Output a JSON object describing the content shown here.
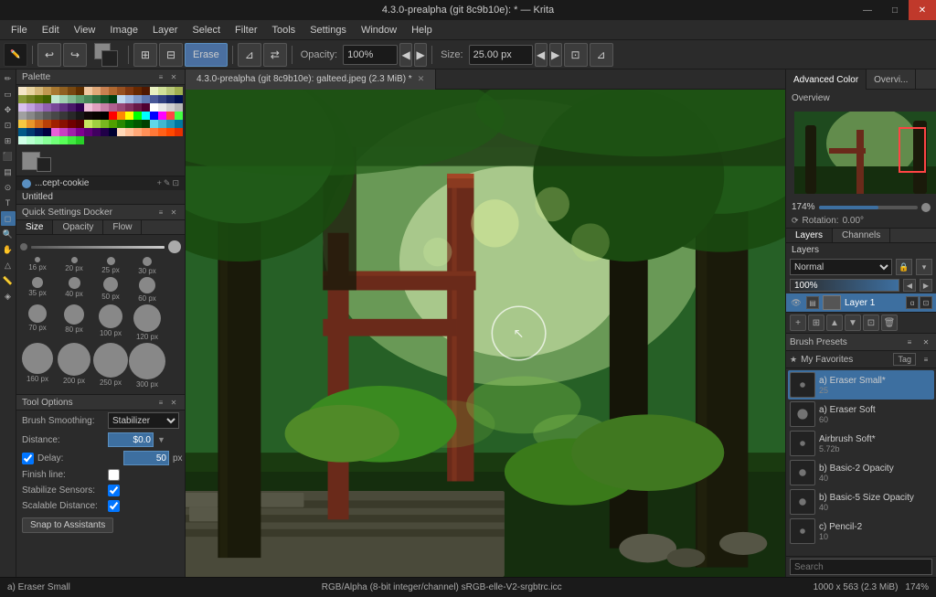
{
  "app": {
    "title": "4.3.0-prealpha (git 8c9b10e): * — Krita",
    "version": "4.3.0-prealpha (git 8c9b10e)"
  },
  "titlebar": {
    "title": "4.3.0-prealpha (git 8c9b10e): * — Krita",
    "minimize_label": "—",
    "maximize_label": "□",
    "close_label": "✕"
  },
  "menubar": {
    "items": [
      "File",
      "Edit",
      "View",
      "Image",
      "Layer",
      "Select",
      "Filter",
      "Tools",
      "Settings",
      "Window",
      "Help"
    ]
  },
  "toolbar": {
    "erase_label": "Erase",
    "opacity_label": "Opacity:",
    "opacity_value": "100%",
    "size_label": "Size:",
    "size_value": "25.00 px"
  },
  "canvas_tab": {
    "title": "4.3.0-prealpha (git 8c9b10e): galteed.jpeg (2.3 MiB) *"
  },
  "palette": {
    "title": "Palette",
    "swatch_name": "...cept-cookie",
    "colors": [
      "#f5e6c8",
      "#e8d4a0",
      "#d4b878",
      "#c09850",
      "#a87830",
      "#906020",
      "#784810",
      "#603000",
      "#f0c8a0",
      "#e0a878",
      "#c88050",
      "#b06830",
      "#985020",
      "#803810",
      "#682800",
      "#501800",
      "#e8f0c0",
      "#d0e098",
      "#b8c878",
      "#a0b050",
      "#889838",
      "#708020",
      "#587008",
      "#406000",
      "#c0e8d0",
      "#a0d0b0",
      "#80b890",
      "#60a070",
      "#488858",
      "#307040",
      "#185828",
      "#004010",
      "#c0d8f0",
      "#a0b8e0",
      "#8098c8",
      "#6078b0",
      "#485898",
      "#304080",
      "#182868",
      "#001050",
      "#d8c0f0",
      "#c0a0e0",
      "#a880c8",
      "#9060b0",
      "#784898",
      "#603080",
      "#481868",
      "#300050",
      "#f0c0d8",
      "#e0a0c0",
      "#c880a8",
      "#b06090",
      "#984878",
      "#803060",
      "#681848",
      "#500030",
      "#ffffff",
      "#e8e8e8",
      "#d0d0d0",
      "#b8b8b8",
      "#a0a0a0",
      "#888888",
      "#707070",
      "#585858",
      "#484848",
      "#383838",
      "#282828",
      "#181818",
      "#100808",
      "#080400",
      "#000000",
      "#ff0000",
      "#ff8800",
      "#ffff00",
      "#00ff00",
      "#00ffff",
      "#0000ff",
      "#ff00ff",
      "#ff4444",
      "#44ff44",
      "#f5c842",
      "#e8962a",
      "#d06818",
      "#b84008",
      "#a02000",
      "#881000",
      "#700000",
      "#580000",
      "#c8e860",
      "#a0d040",
      "#78b820",
      "#50a000",
      "#288800",
      "#007000",
      "#005800",
      "#004000",
      "#60d8e8",
      "#40b8d0",
      "#2098b8",
      "#0078a0",
      "#005888",
      "#003870",
      "#001858",
      "#000040",
      "#e860d8",
      "#c840c0",
      "#a020a8",
      "#800090",
      "#600078",
      "#400060",
      "#200048",
      "#000030",
      "#ffd8b8",
      "#ffc098",
      "#ffa878",
      "#ff9058",
      "#ff7838",
      "#ff6018",
      "#ff4800",
      "#e83000",
      "#d0ffe8",
      "#b8ffd0",
      "#a0ffb8",
      "#88ff98",
      "#70ff78",
      "#58ff58",
      "#40e840",
      "#28d028"
    ]
  },
  "quick_settings": {
    "title": "Quick Settings Docker",
    "tabs": [
      "Size",
      "Opacity",
      "Flow"
    ],
    "active_tab": "Size",
    "sizes": [
      {
        "label": "16 px",
        "size": 6
      },
      {
        "label": "20 px",
        "size": 7
      },
      {
        "label": "25 px",
        "size": 9
      },
      {
        "label": "30 px",
        "size": 10
      },
      {
        "label": "35 px",
        "size": 12
      },
      {
        "label": "40 px",
        "size": 13
      },
      {
        "label": "50 px",
        "size": 16
      },
      {
        "label": "60 px",
        "size": 18
      },
      {
        "label": "70 px",
        "size": 20
      },
      {
        "label": "80 px",
        "size": 22
      },
      {
        "label": "100 px",
        "size": 26
      },
      {
        "label": "120 px",
        "size": 30
      },
      {
        "label": "160 px",
        "size": 34
      },
      {
        "label": "200 px",
        "size": 36
      },
      {
        "label": "250 px",
        "size": 38
      },
      {
        "label": "300 px",
        "size": 40
      }
    ]
  },
  "tool_options": {
    "title": "Tool Options",
    "brush_smoothing_label": "Brush Smoothing:",
    "brush_smoothing_value": "Stabilizer",
    "distance_label": "Distance:",
    "distance_value": "$0.0",
    "delay_label": "Delay:",
    "delay_value": "50",
    "delay_unit": "px",
    "finish_line_label": "Finish line:",
    "stabilize_sensors_label": "Stabilize Sensors:",
    "scalable_distance_label": "Scalable Distance:",
    "snap_btn_label": "Snap to Assistants"
  },
  "right_panel": {
    "advanced_color_tab": "Advanced Color",
    "overview_tab": "Overvi...",
    "overview_title": "Overview",
    "zoom_value": "174%",
    "rotation_label": "Rotation:",
    "rotation_value": "0.00°"
  },
  "layers": {
    "title": "Layers",
    "tabs": [
      "Layers",
      "Channels"
    ],
    "active_tab": "Layers",
    "blend_mode": "Normal",
    "opacity_value": "100%",
    "items": [
      {
        "name": "Layer 1",
        "visible": true,
        "active": true
      }
    ]
  },
  "brush_presets": {
    "title": "Brush Presets",
    "category": "My Favorites",
    "tag_label": "Tag",
    "items": [
      {
        "size": "25",
        "name": "a) Eraser Small*",
        "active": true
      },
      {
        "size": "60",
        "name": "a) Eraser Soft",
        "active": false
      },
      {
        "size": "5.72b",
        "name": "Airbrush Soft*",
        "active": false
      },
      {
        "size": "40",
        "name": "b) Basic-2 Opacity",
        "active": false
      },
      {
        "size": "40",
        "name": "b) Basic-5 Size Opacity",
        "active": false
      },
      {
        "size": "10",
        "name": "c) Pencil-2",
        "active": false
      }
    ],
    "search_placeholder": "Search"
  },
  "statusbar": {
    "tool_name": "a) Eraser Small",
    "color_info": "RGB/Alpha (8-bit integer/channel)  sRGB-elle-V2-srgbtrc.icc",
    "image_size": "1000 x 563 (2.3 MiB)",
    "zoom_value": "174%"
  }
}
